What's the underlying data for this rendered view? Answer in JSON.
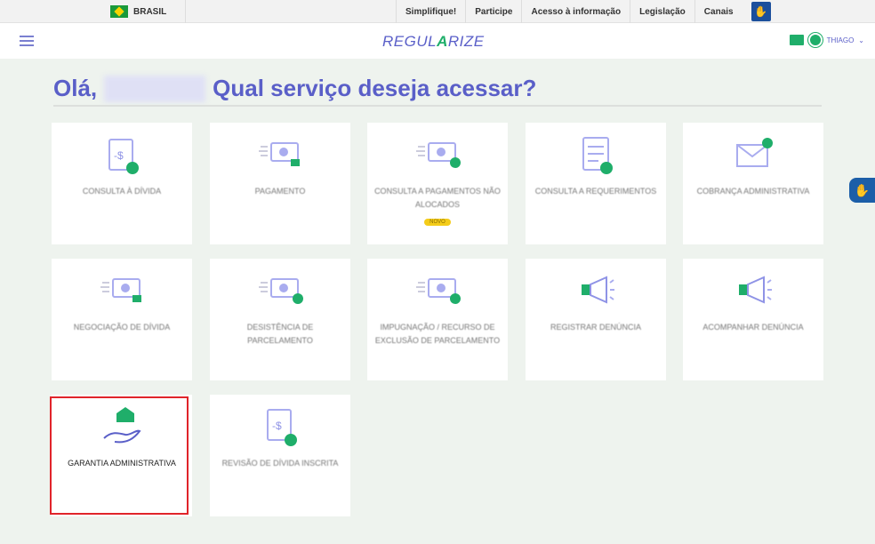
{
  "topbar": {
    "country": "BRASIL",
    "links": [
      "Simplifique!",
      "Participe",
      "Acesso à informação",
      "Legislação",
      "Canais"
    ]
  },
  "header": {
    "logo_left": "REGUL",
    "logo_mark": "A",
    "logo_right": "RIZE",
    "user": "THIAGO"
  },
  "greeting": {
    "hello": "Olá,",
    "question": "Qual serviço deseja acessar?"
  },
  "cards": [
    {
      "label": "Consulta à Dívida",
      "icon": "document-search-icon"
    },
    {
      "label": "Pagamento",
      "icon": "money-check-icon"
    },
    {
      "label": "Consulta a Pagamentos Não Alocados",
      "icon": "money-question-icon",
      "badge": "NOVO"
    },
    {
      "label": "Consulta a Requerimentos",
      "icon": "form-search-icon"
    },
    {
      "label": "Cobrança Administrativa",
      "icon": "envelope-money-icon"
    },
    {
      "label": "Negociação de Dívida",
      "icon": "money-check-icon"
    },
    {
      "label": "Desistência de Parcelamento",
      "icon": "money-back-icon"
    },
    {
      "label": "Impugnação / Recurso de Exclusão de Parcelamento",
      "icon": "money-x-icon"
    },
    {
      "label": "Registrar Denúncia",
      "icon": "megaphone-icon"
    },
    {
      "label": "Acompanhar Denúncia",
      "icon": "megaphone-icon"
    },
    {
      "label": "Garantia Administrativa",
      "icon": "house-hand-icon"
    },
    {
      "label": "Revisão de Dívida Inscrita",
      "icon": "document-edit-icon"
    }
  ],
  "colors": {
    "accent": "#5a5fc8",
    "green": "#1fae6a",
    "highlight": "#e0242a"
  }
}
